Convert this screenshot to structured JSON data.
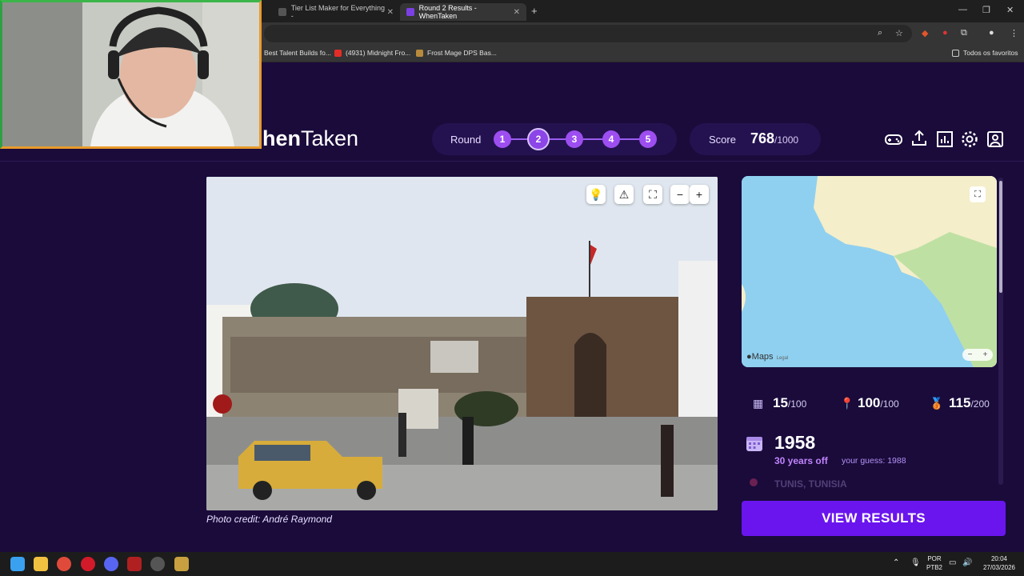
{
  "browser": {
    "tabs": [
      {
        "label": "Tier List Maker for Everything -",
        "active": false
      },
      {
        "label": "Round 2 Results - WhenTaken",
        "active": true
      }
    ],
    "bookmarks": [
      "Best Talent Builds fo...",
      "(4931) Midnight Fro...",
      "Frost Mage DPS Bas..."
    ],
    "all_bookmarks_label": "Todos os favoritos"
  },
  "site": {
    "logo_bold": "hen",
    "logo_rest": "Taken",
    "round_label": "Round",
    "rounds": [
      "1",
      "2",
      "3",
      "4",
      "5"
    ],
    "current_round": "2",
    "score_label": "Score",
    "score_value": "768",
    "score_max": "/1000",
    "header_icons": [
      "gamepad-icon",
      "share-icon",
      "stats-icon",
      "settings-icon",
      "profile-icon"
    ]
  },
  "photo": {
    "credit": "Photo credit: André Raymond",
    "controls": [
      "lightbulb-icon",
      "warning-icon",
      "fullscreen-icon",
      "zoom-out-icon",
      "zoom-in-icon"
    ]
  },
  "map": {
    "brand": "Maps",
    "legal": "Legal",
    "zoom_out": "−",
    "zoom_in": "+"
  },
  "results": {
    "year_score": "15",
    "year_score_max": "/100",
    "location_score": "100",
    "location_score_max": "/100",
    "total_score": "115",
    "total_score_max": "/200",
    "actual_year": "1958",
    "years_off": "30 years off",
    "your_guess": "your guess: 1988",
    "location": "TUNIS, TUNISIA",
    "view_results": "VIEW RESULTS"
  },
  "system": {
    "lang_top": "POR",
    "lang_bottom": "PTB2",
    "time": "20:04",
    "date": "27/03/2026"
  },
  "colors": {
    "background": "#1a0b3b",
    "accent": "#6a15ee",
    "round_dot": "#9d4ef0",
    "years_off": "#c084fc"
  }
}
